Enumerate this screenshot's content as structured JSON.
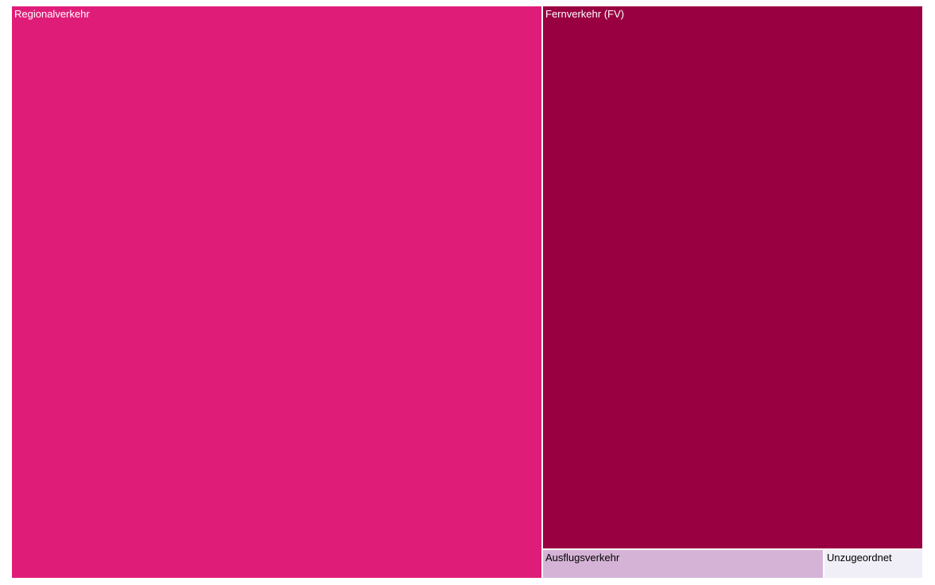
{
  "chart_data": {
    "type": "treemap",
    "categories": [
      "Regionalverkehr",
      "Fernverkehr (FV)",
      "Ausflugsverkehr",
      "Unzugeordnet"
    ],
    "values": [
      48000,
      32750,
      1330,
      470
    ],
    "colors": [
      "#df1d79",
      "#990041",
      "#d5b3d6",
      "#f0eef6"
    ],
    "label_colors": [
      "#ffffff",
      "#ffffff",
      "#000000",
      "#000000"
    ]
  }
}
